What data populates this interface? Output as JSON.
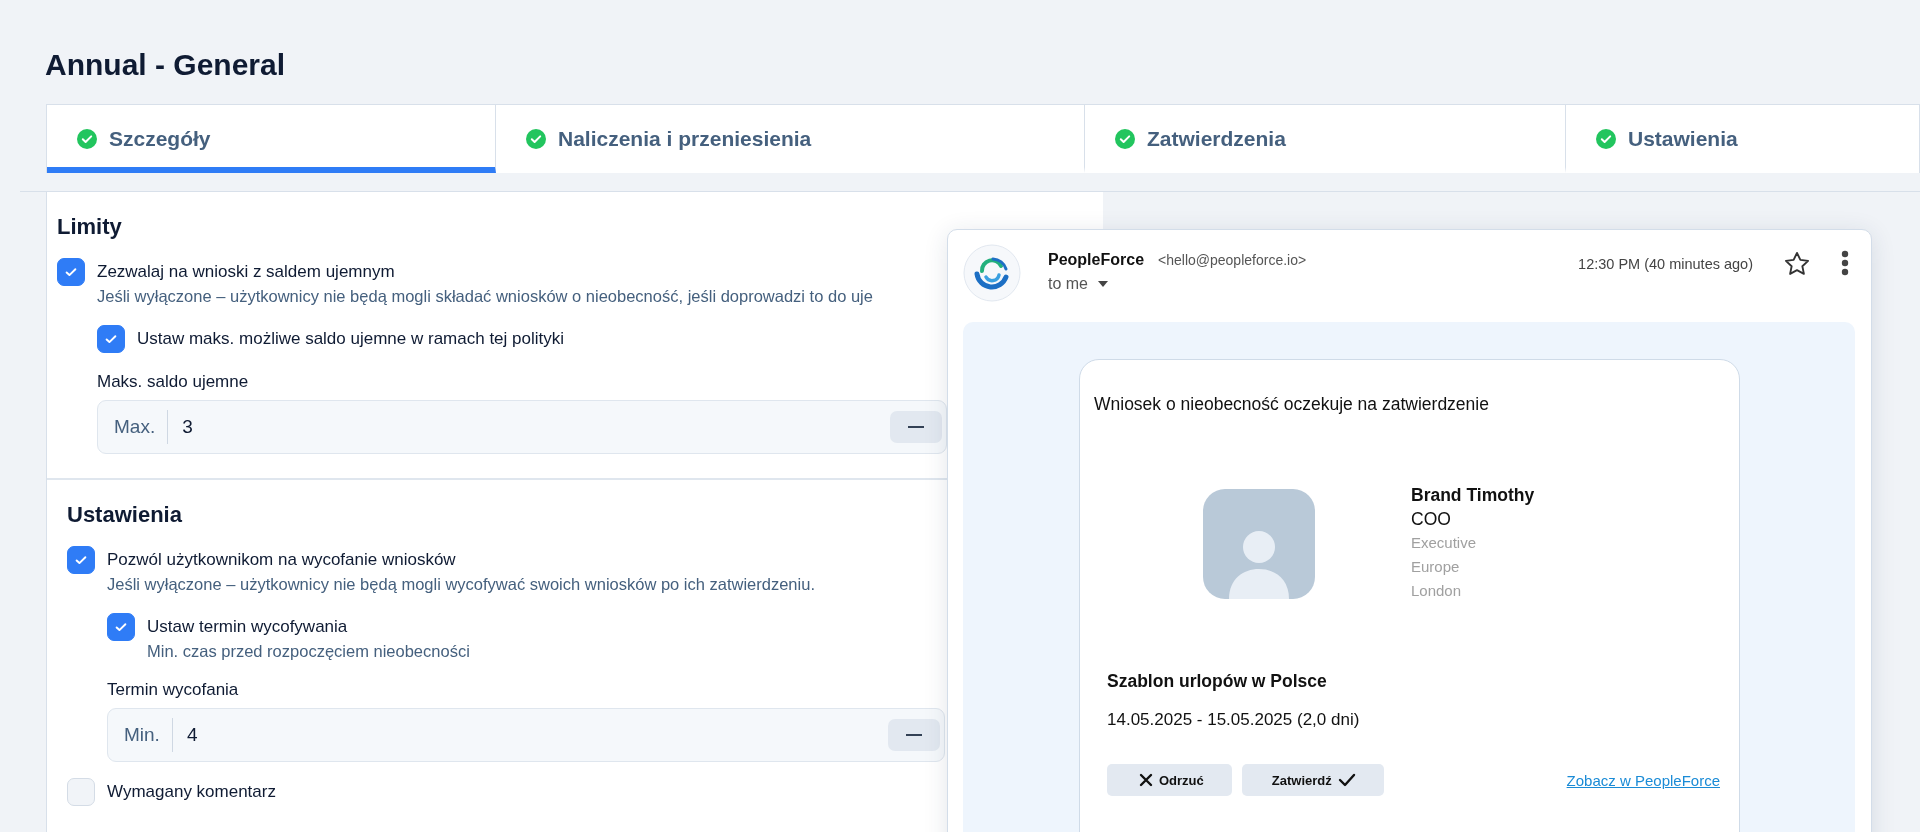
{
  "page": {
    "title": "Annual - General"
  },
  "tabs": [
    {
      "label": "Szczegóły",
      "selected": true,
      "completed": true
    },
    {
      "label": "Naliczenia i przeniesienia",
      "selected": false,
      "completed": true
    },
    {
      "label": "Zatwierdzenia",
      "selected": false,
      "completed": true
    },
    {
      "label": "Ustawienia",
      "selected": false,
      "completed": true
    }
  ],
  "sections": [
    {
      "title": "Limity",
      "items": [
        {
          "kind": "checkbox",
          "label": "Zezwalaj na wnioski z saldem ujemnym",
          "description": "Jeśli wyłączone – użytkownicy nie będą mogli składać wniosków o nieobecność, jeśli doprowadzi to do uje",
          "checked": true,
          "children": [
            {
              "kind": "checkbox",
              "label": "Ustaw maks. możliwe saldo ujemne w ramach tej polityki",
              "checked": true
            },
            {
              "kind": "number_field",
              "label": "Maks. saldo ujemne",
              "prefix": "Max.",
              "value": "3"
            }
          ]
        }
      ]
    },
    {
      "title": "Ustawienia",
      "items": [
        {
          "kind": "checkbox",
          "label": "Pozwól użytkownikom na wycofanie wniosków",
          "description": "Jeśli wyłączone – użytkownicy nie będą mogli wycofywać swoich wniosków po ich zatwierdzeniu.",
          "checked": true,
          "children": [
            {
              "kind": "checkbox",
              "label": "Ustaw termin wycofywania",
              "description": "Min. czas przed rozpoczęciem nieobecności",
              "checked": true
            },
            {
              "kind": "number_field",
              "label": "Termin wycofania",
              "prefix": "Min.",
              "value": "4"
            }
          ]
        },
        {
          "kind": "checkbox",
          "label": "Wymagany komentarz",
          "checked": false
        }
      ]
    }
  ],
  "email": {
    "sender": "PeopleForce",
    "sender_address": "<hello@peopleforce.io>",
    "recipient": "to me",
    "time": "12:30 PM (40 minutes ago)",
    "starred": false,
    "message": {
      "heading": "Wniosek o nieobecność oczekuje na zatwierdzenie",
      "person": {
        "name": "Brand Timothy",
        "title": "COO",
        "details": [
          "Executive",
          "Europe",
          "London"
        ]
      },
      "policy": "Szablon urlopów w Polsce",
      "dates": "14.05.2025 - 15.05.2025 (2,0 dni)",
      "buttons": [
        {
          "kind": "reject",
          "label": "Odrzuć"
        },
        {
          "kind": "approve",
          "label": "Zatwierdź"
        }
      ],
      "link": "Zobacz w PeopleForce"
    }
  }
}
